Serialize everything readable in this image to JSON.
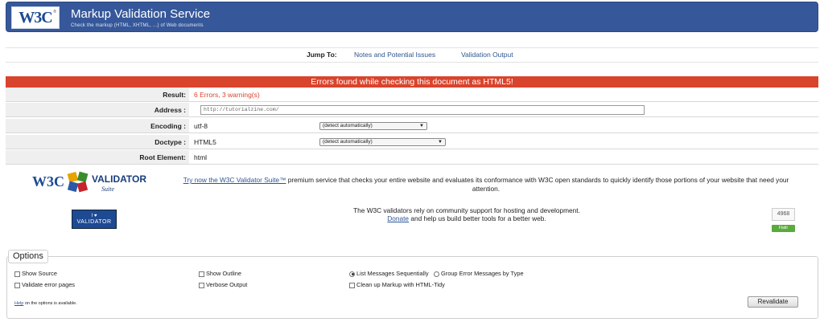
{
  "banner": {
    "logo_text": "W3C",
    "logo_reg": "®",
    "title": "Markup Validation Service",
    "subtitle": "Check the markup (HTML, XHTML, ...) of Web documents"
  },
  "jump": {
    "label": "Jump To:",
    "links": [
      "Notes and Potential Issues",
      "Validation Output"
    ]
  },
  "result": {
    "banner": "Errors found while checking this document as HTML5!",
    "result_label": "Result:",
    "result_value": "6 Errors, 3 warning(s)",
    "address_label": "Address :",
    "address_value": "http://tutorialzine.com/",
    "encoding_label": "Encoding :",
    "encoding_value": "utf-8",
    "encoding_select": "(detect automatically)",
    "doctype_label": "Doctype :",
    "doctype_value": "HTML5",
    "doctype_select": "(detect automatically)",
    "root_label": "Root Element:",
    "root_value": "html"
  },
  "promo": {
    "logo_w3c": "W3C",
    "logo_validator": "VALIDATOR",
    "logo_suite": "Suite",
    "link_text": "Try now the W3C Validator Suite™",
    "body_text": " premium service that checks your entire website and evaluates its conformance with W3C open standards to quickly identify those portions of your website that need your attention.",
    "ilove_top": "I ♥",
    "ilove_bottom": "VALIDATOR",
    "donate_line1": "The W3C validators rely on community support for hosting and development.",
    "donate_link": "Donate",
    "donate_line2": " and help us build better tools for a better web.",
    "counter": "4968",
    "flattr": "Flattr"
  },
  "options": {
    "legend": "Options",
    "show_source": "Show Source",
    "show_outline": "Show Outline",
    "list_sequential": "List Messages Sequentially",
    "group_by_type": "Group Error Messages by Type",
    "validate_error_pages": "Validate error pages",
    "verbose_output": "Verbose Output",
    "cleanup_tidy": "Clean up Markup with HTML-Tidy",
    "help_link": "Help",
    "help_text": " on the options is available.",
    "revalidate": "Revalidate"
  },
  "colors": {
    "banner_bg": "#36589a",
    "error_bar": "#d9442c",
    "error_text": "#d9442c",
    "link": "#2d5593"
  }
}
